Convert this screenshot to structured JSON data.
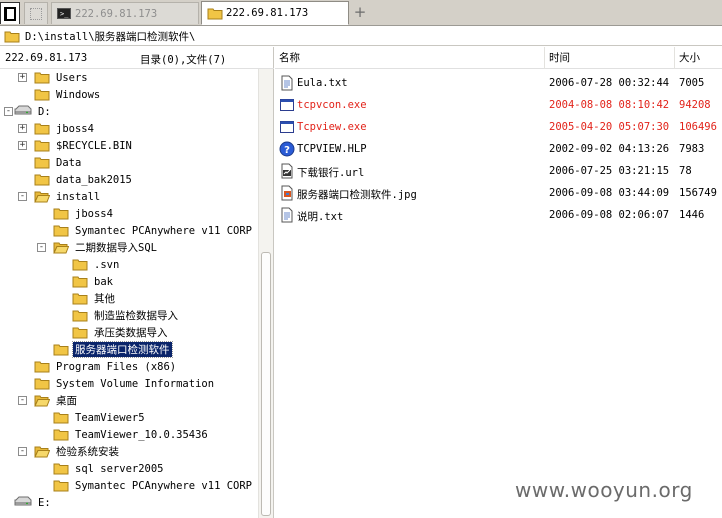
{
  "tabs": [
    {
      "label": "",
      "icon": "panel-icon"
    },
    {
      "label": "",
      "icon": "blank-tab-icon"
    },
    {
      "label": "222.69.81.173",
      "icon": "terminal-icon"
    },
    {
      "label": "222.69.81.173",
      "icon": "folder-icon",
      "active": true
    }
  ],
  "address": {
    "path": "D:\\install\\服务器端口检测软件\\"
  },
  "left": {
    "host": "222.69.81.173",
    "counts": "目录(0),文件(7)"
  },
  "tree": [
    {
      "label": "Users",
      "level": 1,
      "expander": "+",
      "type": "folder"
    },
    {
      "label": "Windows",
      "level": 1,
      "expander": "",
      "type": "folder"
    },
    {
      "label": "D:",
      "level": 0,
      "expander": "-",
      "type": "drive"
    },
    {
      "label": "jboss4",
      "level": 1,
      "expander": "+",
      "type": "folder"
    },
    {
      "label": "$RECYCLE.BIN",
      "level": 1,
      "expander": "+",
      "type": "folder"
    },
    {
      "label": "Data",
      "level": 1,
      "expander": "",
      "type": "folder"
    },
    {
      "label": "data_bak2015",
      "level": 1,
      "expander": "",
      "type": "folder"
    },
    {
      "label": "install",
      "level": 1,
      "expander": "-",
      "type": "folder"
    },
    {
      "label": "jboss4",
      "level": 2,
      "expander": "",
      "type": "folder"
    },
    {
      "label": "Symantec PCAnywhere v11 CORP",
      "level": 2,
      "expander": "",
      "type": "folder"
    },
    {
      "label": "二期数据导入SQL",
      "level": 2,
      "expander": "-",
      "type": "folder"
    },
    {
      "label": ".svn",
      "level": 3,
      "expander": "",
      "type": "folder"
    },
    {
      "label": "bak",
      "level": 3,
      "expander": "",
      "type": "folder"
    },
    {
      "label": "其他",
      "level": 3,
      "expander": "",
      "type": "folder"
    },
    {
      "label": "制造监检数据导入",
      "level": 3,
      "expander": "",
      "type": "folder"
    },
    {
      "label": "承压类数据导入",
      "level": 3,
      "expander": "",
      "type": "folder"
    },
    {
      "label": "服务器端口检测软件",
      "level": 2,
      "expander": "",
      "type": "folder",
      "selected": true
    },
    {
      "label": "Program Files (x86)",
      "level": 1,
      "expander": "",
      "type": "folder"
    },
    {
      "label": "System Volume Information",
      "level": 1,
      "expander": "",
      "type": "folder"
    },
    {
      "label": "桌面",
      "level": 1,
      "expander": "-",
      "type": "folder"
    },
    {
      "label": "TeamViewer5",
      "level": 2,
      "expander": "",
      "type": "folder"
    },
    {
      "label": "TeamViewer_10.0.35436",
      "level": 2,
      "expander": "",
      "type": "folder"
    },
    {
      "label": "检验系统安装",
      "level": 1,
      "expander": "-",
      "type": "folder"
    },
    {
      "label": "sql server2005",
      "level": 2,
      "expander": "",
      "type": "folder"
    },
    {
      "label": "Symantec PCAnywhere v11 CORP",
      "level": 2,
      "expander": "",
      "type": "folder"
    },
    {
      "label": "E:",
      "level": 0,
      "expander": "",
      "type": "drive"
    }
  ],
  "columns": {
    "name": "名称",
    "time": "时间",
    "size": "大小"
  },
  "files": [
    {
      "name": "Eula.txt",
      "time": "2006-07-28 00:32:44",
      "size": "7005",
      "icon": "text-file-icon",
      "highlight": false
    },
    {
      "name": "tcpvcon.exe",
      "time": "2004-08-08 08:10:42",
      "size": "94208",
      "icon": "exe-file-icon",
      "highlight": true
    },
    {
      "name": "Tcpview.exe",
      "time": "2005-04-20 05:07:30",
      "size": "106496",
      "icon": "exe-file-icon",
      "highlight": true
    },
    {
      "name": "TCPVIEW.HLP",
      "time": "2002-09-02 04:13:26",
      "size": "7983",
      "icon": "help-file-icon",
      "highlight": false
    },
    {
      "name": "下载银行.url",
      "time": "2006-07-25 03:21:15",
      "size": "78",
      "icon": "url-file-icon",
      "highlight": false
    },
    {
      "name": "服务器端口检测软件.jpg",
      "time": "2006-09-08 03:44:09",
      "size": "156749",
      "icon": "image-file-icon",
      "highlight": false
    },
    {
      "name": "说明.txt",
      "time": "2006-09-08 02:06:07",
      "size": "1446",
      "icon": "text-file-icon",
      "highlight": false
    }
  ],
  "watermark": "www.wooyun.org",
  "colors": {
    "highlight": "#e2231a",
    "selection": "#0a246a",
    "folder": "#f1c545"
  }
}
